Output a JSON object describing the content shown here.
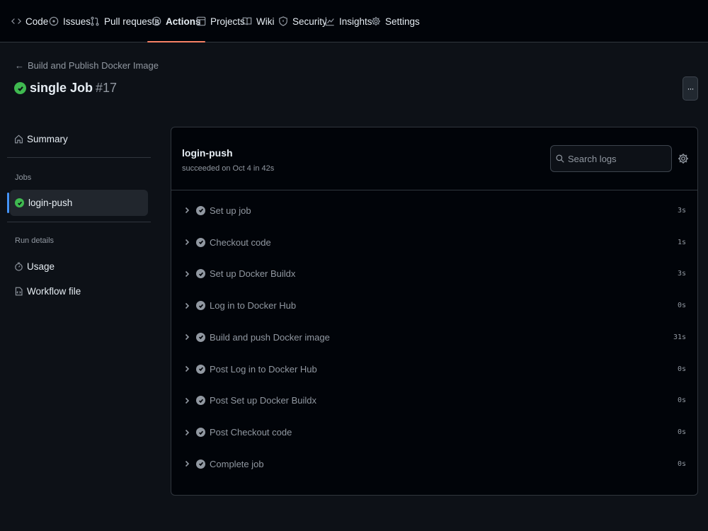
{
  "nav": {
    "tabs": [
      {
        "label": "Code",
        "icon": "code-icon"
      },
      {
        "label": "Issues",
        "icon": "issue-icon"
      },
      {
        "label": "Pull requests",
        "icon": "pull-request-icon"
      },
      {
        "label": "Actions",
        "icon": "play-icon",
        "active": true
      },
      {
        "label": "Projects",
        "icon": "table-icon"
      },
      {
        "label": "Wiki",
        "icon": "book-icon"
      },
      {
        "label": "Security",
        "icon": "shield-icon"
      },
      {
        "label": "Insights",
        "icon": "graph-icon"
      },
      {
        "label": "Settings",
        "icon": "gear-icon"
      }
    ]
  },
  "header": {
    "back_label": "Build and Publish Docker Image",
    "title": "single Job",
    "run_number": "#17",
    "more_label": "···"
  },
  "sidebar": {
    "summary": "Summary",
    "jobs_label": "Jobs",
    "job": "login-push",
    "run_details_label": "Run details",
    "usage": "Usage",
    "workflow_file": "Workflow file"
  },
  "job": {
    "name": "login-push",
    "status": "succeeded on Oct 4 in 42s",
    "search_placeholder": "Search logs"
  },
  "steps": [
    {
      "name": "Set up job",
      "duration": "3s"
    },
    {
      "name": "Checkout code",
      "duration": "1s"
    },
    {
      "name": "Set up Docker Buildx",
      "duration": "3s"
    },
    {
      "name": "Log in to Docker Hub",
      "duration": "0s"
    },
    {
      "name": "Build and push Docker image",
      "duration": "31s"
    },
    {
      "name": "Post Log in to Docker Hub",
      "duration": "0s"
    },
    {
      "name": "Post Set up Docker Buildx",
      "duration": "0s"
    },
    {
      "name": "Post Checkout code",
      "duration": "0s"
    },
    {
      "name": "Complete job",
      "duration": "0s"
    }
  ],
  "colors": {
    "background": "#0d1117",
    "success": "#3fb950",
    "accent_underline": "#f78166",
    "selected_bar": "#4493f8"
  }
}
